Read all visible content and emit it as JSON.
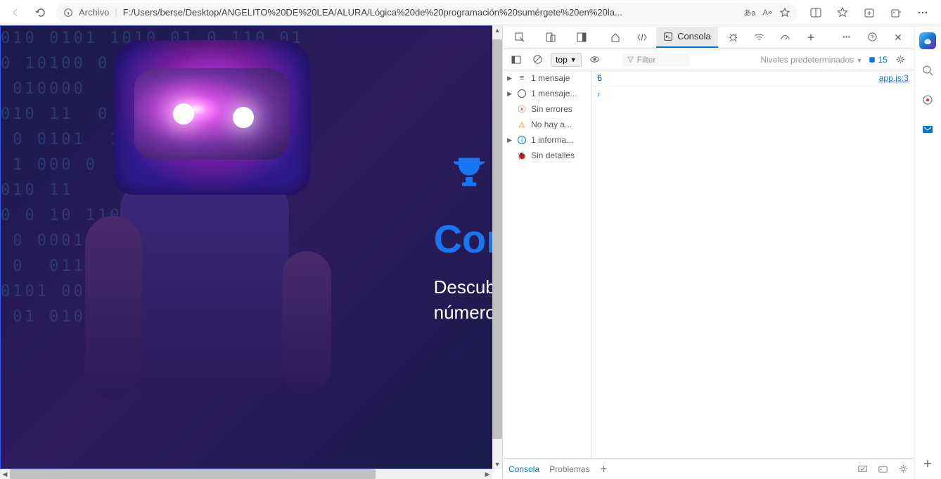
{
  "browser": {
    "url_prefix": "Archivo",
    "url": "F:/Users/berse/Desktop/ANGELITO%20DE%20LEA/ALURA/Lógica%20de%20programación%20sumérgete%20en%20la...",
    "translate_icon": "あa",
    "reader_icon": "A»"
  },
  "page": {
    "title_visible": "Cor",
    "subtitle_line1": "Descub",
    "subtitle_line2": "número"
  },
  "devtools": {
    "tabs": {
      "welcome": "",
      "elements": "",
      "console": "Consola"
    },
    "toolbar": {
      "context": "top",
      "filter_placeholder": "Filter",
      "levels": "Niveles predeterminados",
      "issues_count": "15"
    },
    "sidebar": {
      "messages": "1 mensaje",
      "user_msgs": "1 mensaje...",
      "no_errors": "Sin errores",
      "no_warnings": "No hay a...",
      "info": "1 informa...",
      "no_details": "Sin detalles"
    },
    "console": {
      "output_value": "6",
      "source_link": "app.js:3"
    },
    "bottom_tabs": {
      "console": "Consola",
      "problems": "Problemas"
    }
  }
}
